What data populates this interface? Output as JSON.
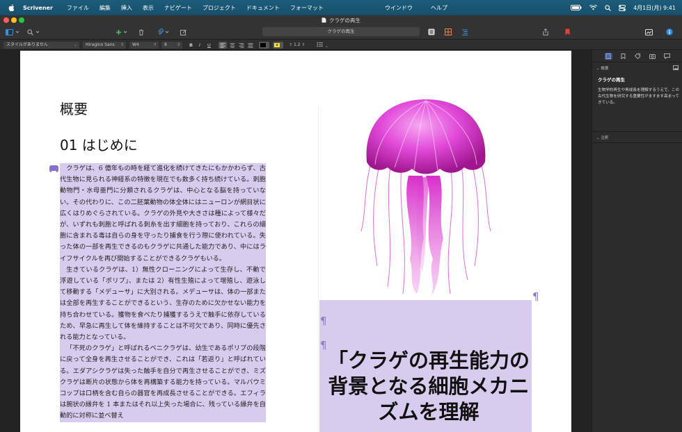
{
  "menubar": {
    "app_name": "Scrivener",
    "items": [
      "ファイル",
      "編集",
      "挿入",
      "表示",
      "ナビゲート",
      "プロジェクト",
      "ドキュメント",
      "フォーマット"
    ],
    "center_items": [
      "ウインドウ",
      "ヘルプ"
    ],
    "clock": "4月1日(月) 9:41"
  },
  "window": {
    "title": "クラゲの再生"
  },
  "toolbar": {
    "title_field": "クラゲの再生"
  },
  "formatbar": {
    "style": "スタイルがありません",
    "font": "Hiragino Sans",
    "weight": "W4",
    "size": "8",
    "bold": "B",
    "italic": "I",
    "underline": "U",
    "line_spacing": "1.2",
    "highlight_label": "a"
  },
  "editor": {
    "heading1": "概要",
    "heading2": "01 はじめに",
    "paragraphs": [
      "クラゲは、6 億年もの時を経て進化を続けてきたにもかかわらず、古代生物に見られる神経系の特徴を現在でも数多く持ち続けている。刺胞動物門・水母亜門に分類されるクラゲは、中心となる脳を持っていない。その代わりに、この二胚葉動物の体全体にはニューロンが網目状に広くはりめぐらされている。クラゲの外見や大きさは種によって様々だが、いずれも刺胞と呼ばれる刺糸を出す細胞を持っており、これらの細胞に含まれる毒は自らの身を守ったり捕食を行う際に使われている。失った体の一部を再生できるのもクラゲに共通した能力であり、中にはライフサイクルを再び開始することができるクラゲもいる。",
      "生きているクラゲは、1）無性クローニングによって生存し、不動で浮遊している「ポリプ」、または 2）有性生殖によって増殖し、遊泳して移動する「メデューサ」に大別される。メデューサは、体の一部または全部を再生することができるという、生存のために欠かせない能力を持ち合わせている。獲物を食べたり捕獲するうえで触手に依存しているため、早急に再生して体を維持することは不可欠であり、同時に優先される能力となっている。",
      "「不死のクラゲ」と呼ばれるベニクラゲは、幼生であるポリプの段階に戻って全身を再生させることができ、これは「若返り」と呼ばれている。エダアシクラゲは失った触手を自分で再生させることができ、ミズクラゲは断片の状態から体を再構築する能力を持っている。マルバウミコップは口柄を含む自らの器官を再成長させることができる。エフィラは腕状の縁弁を 1 本またはそれ以上失った場合に、残っている縁弁を自動的に対称に並べ替え"
    ],
    "callout": "「クラゲの再生能力の背景となる細胞メカニズムを理解"
  },
  "inspector": {
    "synopsis_header": "概要",
    "synopsis_title": "クラゲの再生",
    "synopsis_body": "生物学的再生や再成長を理解するうえで、この古代生物を研究する重要性がますます高まってきている。",
    "notes_header": "注釈"
  },
  "colors": {
    "highlight": "#d7ccee",
    "menubar": "#1c5d7a",
    "accent_blue": "#3b8ee0",
    "bookmark_red": "#e0413b"
  }
}
